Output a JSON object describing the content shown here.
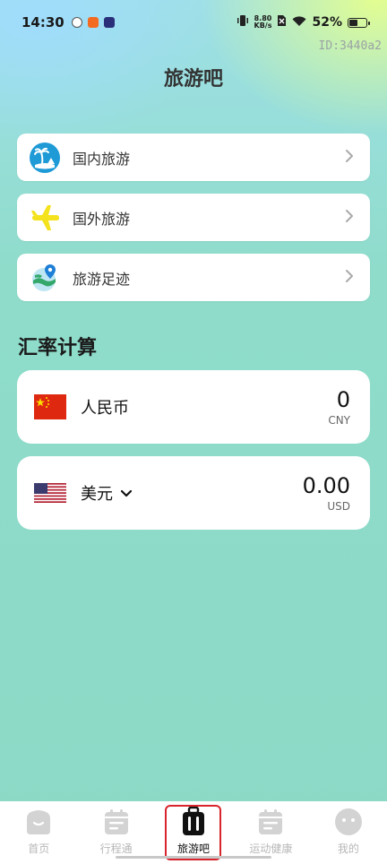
{
  "status_bar": {
    "time": "14:30",
    "net_speed_value": "8.80",
    "net_speed_unit": "KB/s",
    "battery": "52%",
    "battery_level": 0.52
  },
  "id_tag": "ID:3440a2",
  "page_title": "旅游吧",
  "nav_items": [
    {
      "label": "国内旅游",
      "icon": "palm-island-icon"
    },
    {
      "label": "国外旅游",
      "icon": "airplane-icon"
    },
    {
      "label": "旅游足迹",
      "icon": "globe-pin-icon"
    }
  ],
  "exchange": {
    "title": "汇率计算",
    "from": {
      "name": "人民币",
      "amount": "0",
      "code": "CNY",
      "flag": "china-flag-icon"
    },
    "to": {
      "name": "美元",
      "amount": "0.00",
      "code": "USD",
      "flag": "us-flag-icon"
    }
  },
  "tabbar": {
    "tabs": [
      {
        "label": "首页",
        "icon": "home-face-icon"
      },
      {
        "label": "行程通",
        "icon": "calendar-icon"
      },
      {
        "label": "旅游吧",
        "icon": "luggage-icon",
        "active": true
      },
      {
        "label": "运动健康",
        "icon": "calendar-icon"
      },
      {
        "label": "我的",
        "icon": "profile-face-icon"
      }
    ]
  },
  "colors": {
    "accent_red": "#d8242c",
    "icon_blue": "#1e9ad6",
    "plane_yellow": "#f3e21c"
  }
}
